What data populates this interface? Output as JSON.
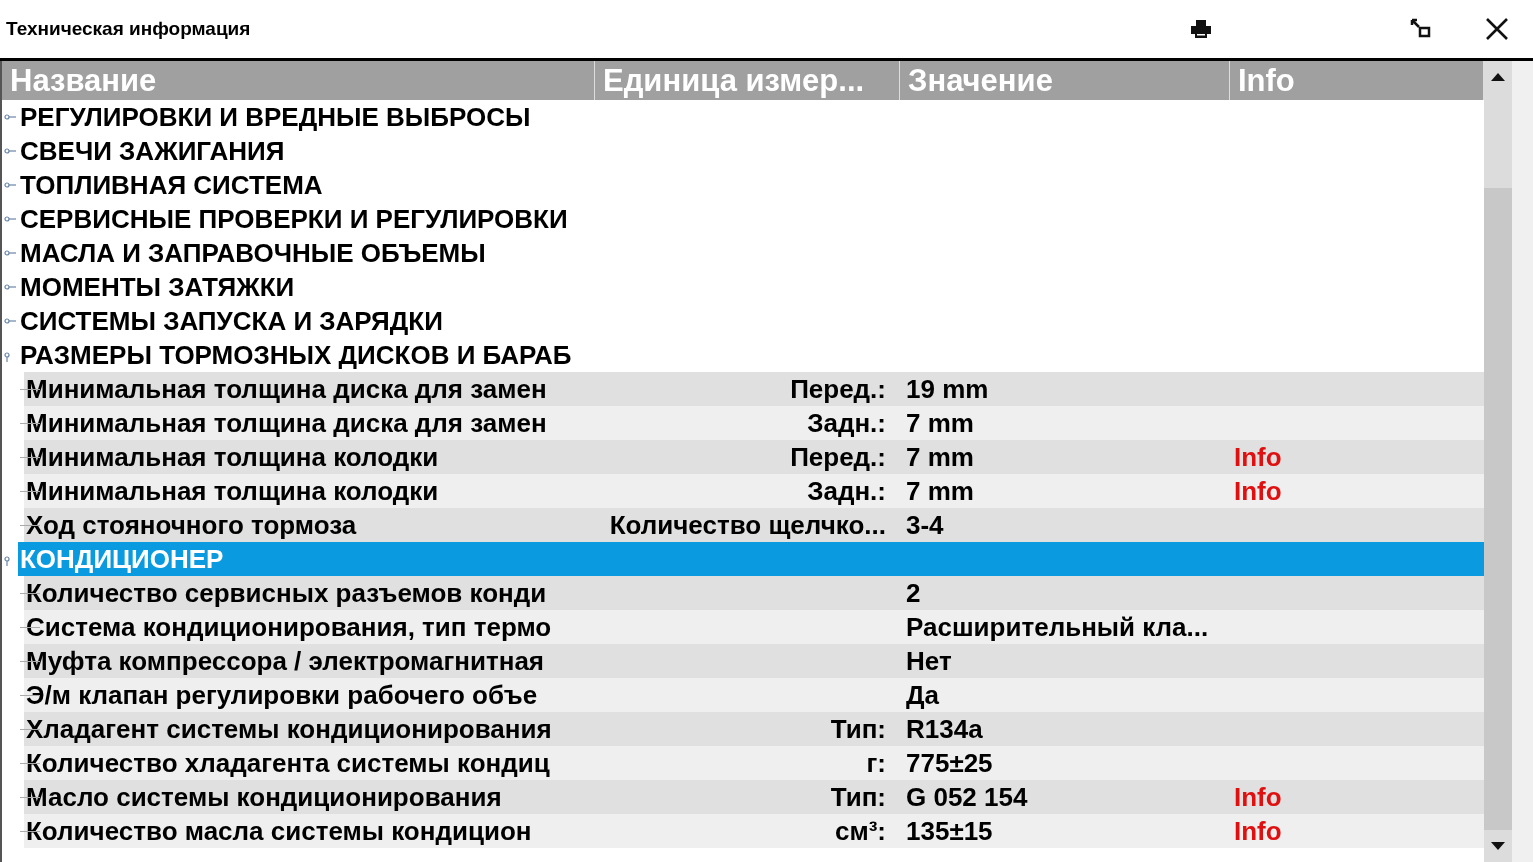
{
  "window": {
    "title": "Техническая информация"
  },
  "table": {
    "columns": [
      "Название",
      "Единица измер...",
      "Значение",
      "Info"
    ],
    "groups": [
      {
        "name": "РЕГУЛИРОВКИ И ВРЕДНЫЕ ВЫБРОСЫ",
        "expanded": false,
        "selected": false
      },
      {
        "name": "СВЕЧИ ЗАЖИГАНИЯ",
        "expanded": false,
        "selected": false
      },
      {
        "name": "ТОПЛИВНАЯ СИСТЕМА",
        "expanded": false,
        "selected": false
      },
      {
        "name": "СЕРВИСНЫЕ ПРОВЕРКИ И РЕГУЛИРОВКИ",
        "expanded": false,
        "selected": false
      },
      {
        "name": "МАСЛА И ЗАПРАВОЧНЫЕ ОБЪЕМЫ",
        "expanded": false,
        "selected": false
      },
      {
        "name": "МОМЕНТЫ ЗАТЯЖКИ",
        "expanded": false,
        "selected": false
      },
      {
        "name": "СИСТЕМЫ ЗАПУСКА И ЗАРЯДКИ",
        "expanded": false,
        "selected": false
      },
      {
        "name": "РАЗМЕРЫ ТОРМОЗНЫХ ДИСКОВ И БАРАБ",
        "expanded": true,
        "selected": false,
        "children": [
          {
            "name": "Минимальная толщина диска для замен",
            "unit": "Перед.:",
            "value": "19 mm"
          },
          {
            "name": "Минимальная толщина диска для замен",
            "unit": "Задн.:",
            "value": "7 mm"
          },
          {
            "name": "Минимальная толщина колодки",
            "unit": "Перед.:",
            "value": "7 mm",
            "info": "Info"
          },
          {
            "name": "Минимальная толщина колодки",
            "unit": "Задн.:",
            "value": "7 mm",
            "info": "Info"
          },
          {
            "name": "Ход стояночного тормоза",
            "unit": "Количество щелчко...",
            "value": "3-4"
          }
        ]
      },
      {
        "name": "КОНДИЦИОНЕР",
        "expanded": true,
        "selected": true,
        "children": [
          {
            "name": "Количество сервисных разъемов конди",
            "value": "2"
          },
          {
            "name": "Система кондиционирования, тип термо",
            "value": "Расширительный кла..."
          },
          {
            "name": "Муфта компрессора / электромагнитная",
            "value": "Нет"
          },
          {
            "name": "Э/м клапан регулировки рабочего объе",
            "value": "Да"
          },
          {
            "name": "Хладагент системы кондиционирования",
            "unit": "Тип:",
            "value": "R134a"
          },
          {
            "name": "Количество хладагента системы кондиц",
            "unit": "г:",
            "value": "775±25"
          },
          {
            "name": "Масло системы кондиционирования",
            "unit": "Тип:",
            "value": "G 052 154",
            "info": "Info"
          },
          {
            "name": "Количество масла системы кондицион",
            "unit": "см³:",
            "value": "135±15",
            "info": "Info"
          }
        ]
      }
    ]
  }
}
